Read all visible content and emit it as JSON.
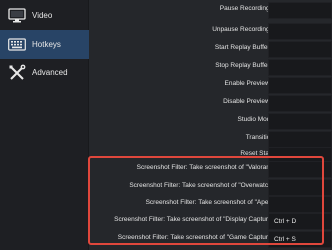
{
  "sidebar": {
    "items": [
      {
        "label": "Video",
        "icon": "monitor-icon"
      },
      {
        "label": "Hotkeys",
        "icon": "keyboard-icon"
      },
      {
        "label": "Advanced",
        "icon": "wrench-screwdriver-icon"
      }
    ]
  },
  "hotkeys": {
    "rows": [
      {
        "label": "Pause Recording *",
        "value": ""
      },
      {
        "label": "Unpause Recording *",
        "value": ""
      },
      {
        "label": "Start Replay Buffer *",
        "value": ""
      },
      {
        "label": "Stop Replay Buffer *",
        "value": ""
      },
      {
        "label": "Enable Preview *",
        "value": ""
      },
      {
        "label": "Disable Preview *",
        "value": ""
      },
      {
        "label": "Studio Mode",
        "value": ""
      },
      {
        "label": "Transition",
        "value": ""
      },
      {
        "label": "Reset Stats",
        "value": ""
      },
      {
        "label": "Screenshot Filter: Take screenshot of \"Valorant\"",
        "value": ""
      },
      {
        "label": "Screenshot Filter: Take screenshot of \"Overwatch\"",
        "value": ""
      },
      {
        "label": "Screenshot Filter: Take screenshot of \"Apex\"",
        "value": ""
      },
      {
        "label": "Screenshot Filter: Take screenshot of \"Display Capture\"",
        "value": "Ctrl + D"
      },
      {
        "label": "Screenshot Filter: Take screenshot of \"Game Capture\"",
        "value": "Ctrl + S"
      }
    ]
  },
  "colors": {
    "highlight": "#e0473c",
    "selected": "#284466"
  }
}
